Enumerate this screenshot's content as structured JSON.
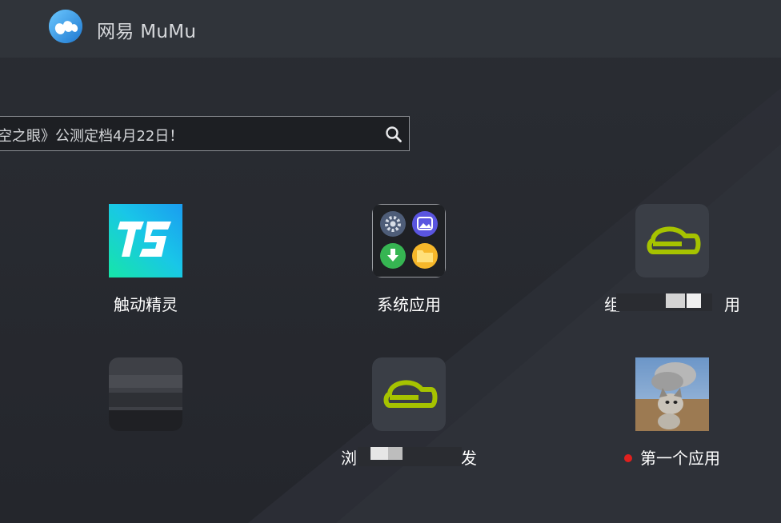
{
  "titlebar": {
    "title": "网易 MuMu"
  },
  "search": {
    "text": "空之眼》公测定档4月22日！"
  },
  "apps": [
    {
      "label": "触动精灵",
      "icon": "ts-logo-icon"
    },
    {
      "label": "系统应用",
      "icon": "system-apps-folder-icon"
    },
    {
      "label": "组",
      "label_tail": "用",
      "icon": "teapot-app-icon"
    },
    {
      "label": "",
      "icon": "blurred-app-icon"
    },
    {
      "label": "浏",
      "label_tail": "发",
      "icon": "teapot-app-icon"
    },
    {
      "label": "第一个应用",
      "icon": "cat-photo-icon",
      "badge": "red-dot"
    }
  ],
  "colors": {
    "accent_green": "#a6c300",
    "tile_dark": "#3a3e46",
    "ts_cyan": "#19c6e8",
    "badge_red": "#e0201e"
  }
}
